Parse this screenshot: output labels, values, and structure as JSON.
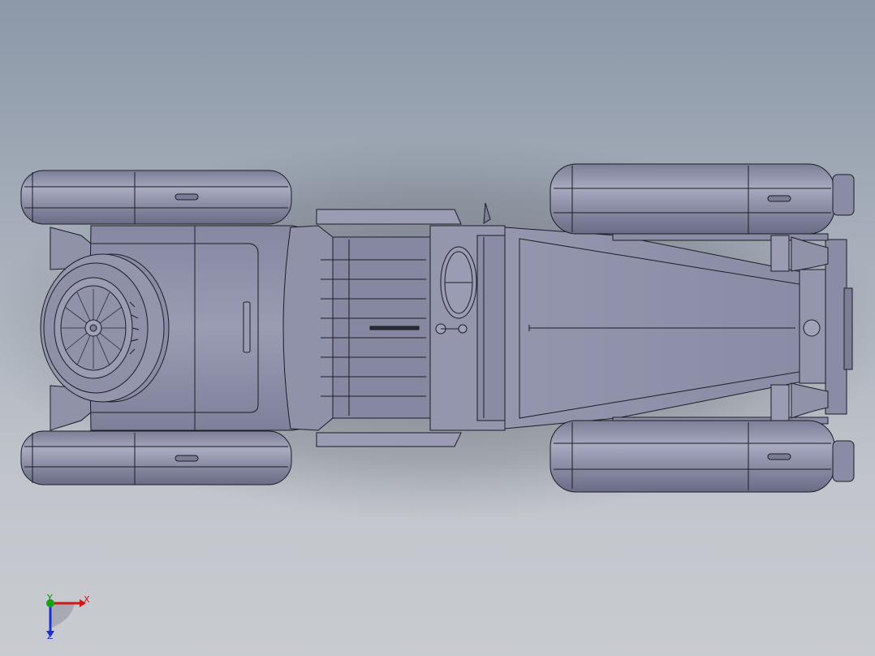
{
  "viewport": {
    "background_top": "#8c98a8",
    "background_bottom": "#c8cbd0",
    "model_color": "#8e90a8",
    "edge_color": "#1c1d24"
  },
  "orientation_triad": {
    "x_label": "X",
    "y_label": "Y",
    "z_label": "Z",
    "x_color": "#d01818",
    "y_color": "#0a8a0a",
    "z_color": "#1a2fd0"
  }
}
